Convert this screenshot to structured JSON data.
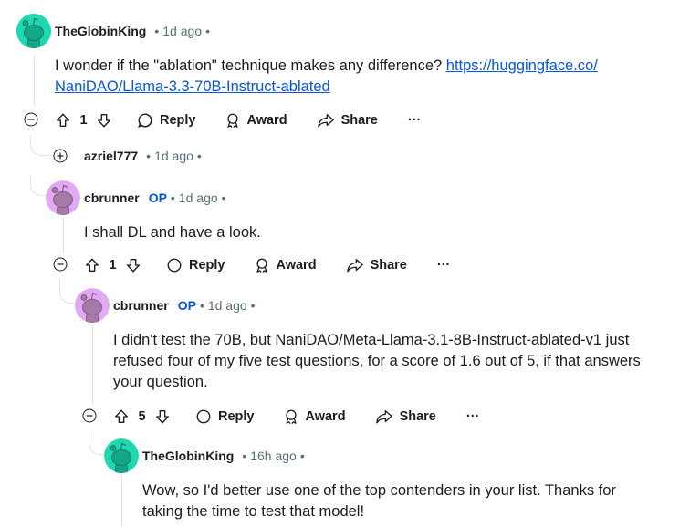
{
  "comments": [
    {
      "author": "TheGlobinKing",
      "time": "1d ago",
      "body": "I wonder if the \"ablation\" technique makes any difference? ",
      "link": "https://huggingface.co/NaniDAO/Llama-3.3-70B-Instruct-ablated",
      "link_line1": "https://huggingface.co/",
      "link_line2": "NaniDAO/Llama-3.3-70B-Instruct-ablated",
      "votes": "1",
      "avatar_color": "#1fd7b0"
    },
    {
      "author": "azriel777",
      "time": "1d ago",
      "collapsed": true
    },
    {
      "author": "cbrunner",
      "op": "OP",
      "time": "1d ago",
      "body": "I shall DL and have a look.",
      "votes": "1",
      "avatar_color": "#e3a8f2"
    },
    {
      "author": "cbrunner",
      "op": "OP",
      "time": "1d ago",
      "body_line1": "I didn't test the 70B, but NaniDAO/Meta-Llama-3.1-8B-Instruct-ablated-v1 just",
      "body_line2": "refused four of my five test questions, for a score of 1.6 out of 5, if that answers",
      "body_line3": "your question.",
      "votes": "5",
      "avatar_color": "#e3a8f2"
    },
    {
      "author": "TheGlobinKing",
      "time": "16h ago",
      "body_line1": "Wow, so I'd better use one of the top contenders in your list. Thanks for",
      "body_line2": "taking the time to test that model!",
      "avatar_color": "#1fd7b0"
    }
  ],
  "labels": {
    "reply": "Reply",
    "award": "Award",
    "share": "Share",
    "more": "···",
    "dot": "•"
  }
}
